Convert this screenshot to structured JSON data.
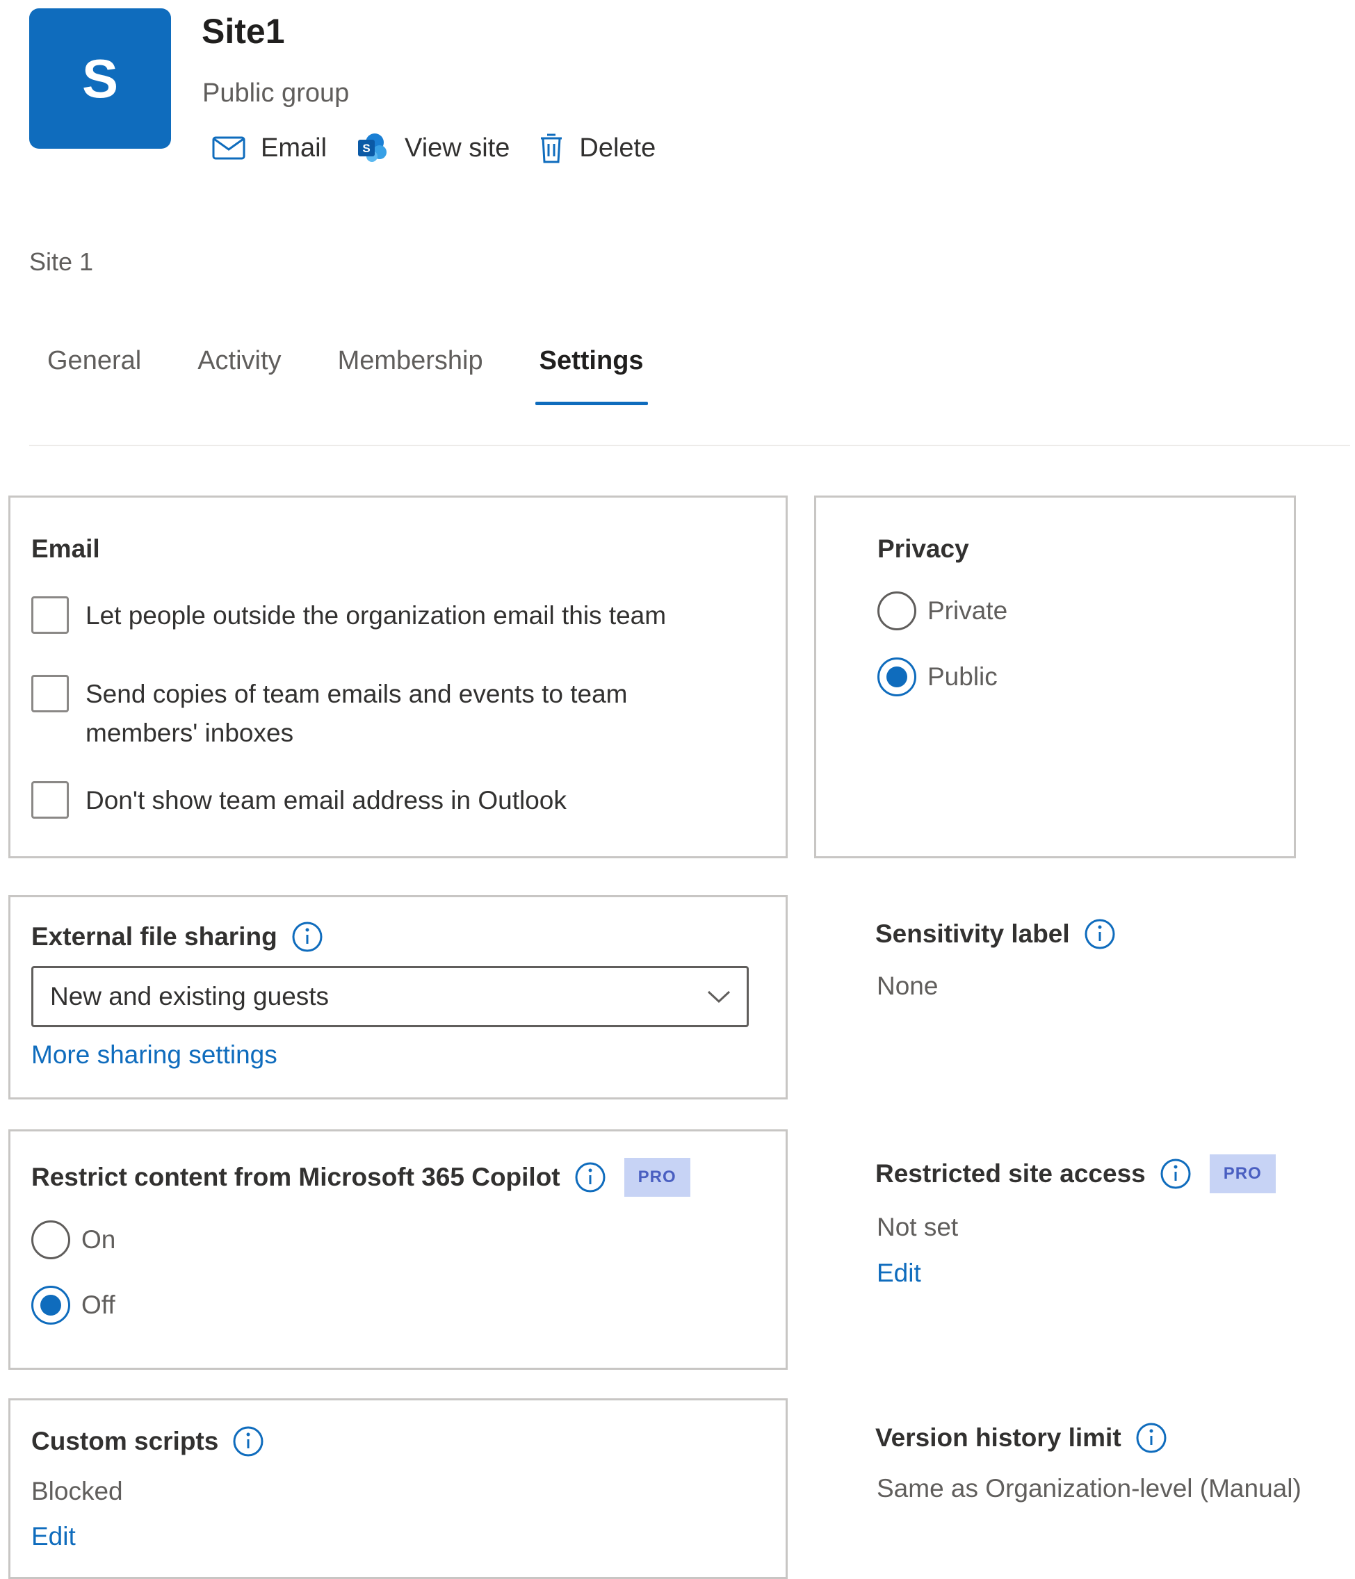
{
  "header": {
    "avatar_letter": "S",
    "title": "Site1",
    "subtitle": "Public group",
    "actions": {
      "email": "Email",
      "view_site": "View site",
      "delete": "Delete"
    }
  },
  "breadcrumb": "Site 1",
  "tabs": [
    {
      "label": "General",
      "active": false
    },
    {
      "label": "Activity",
      "active": false
    },
    {
      "label": "Membership",
      "active": false
    },
    {
      "label": "Settings",
      "active": true
    }
  ],
  "email_card": {
    "title": "Email",
    "options": [
      {
        "line1": "Let people outside the organization email this team",
        "line2": "",
        "checked": false
      },
      {
        "line1": "Send copies of team emails and events to team",
        "line2": "members' inboxes",
        "checked": false
      },
      {
        "line1": "Don't show team email address in Outlook",
        "line2": "",
        "checked": false
      }
    ]
  },
  "privacy_card": {
    "title": "Privacy",
    "options": [
      {
        "label": "Private",
        "selected": false
      },
      {
        "label": "Public",
        "selected": true
      }
    ]
  },
  "external_sharing": {
    "title": "External file sharing",
    "selected_value": "New and existing guests",
    "link": "More sharing settings"
  },
  "sensitivity_label": {
    "title": "Sensitivity label",
    "value": "None"
  },
  "copilot_restrict": {
    "title": "Restrict content from Microsoft 365 Copilot",
    "badge": "PRO",
    "options": [
      {
        "label": "On",
        "selected": false
      },
      {
        "label": "Off",
        "selected": true
      }
    ]
  },
  "restricted_access": {
    "title": "Restricted site access",
    "badge": "PRO",
    "value": "Not set",
    "link": "Edit"
  },
  "custom_scripts": {
    "title": "Custom scripts",
    "value": "Blocked",
    "link": "Edit"
  },
  "version_history": {
    "title": "Version history limit",
    "value": "Same as Organization-level (Manual)"
  },
  "colors": {
    "accent": "#0f6cbd",
    "badge_bg": "#c7d3f5",
    "border": "#c8c6c4"
  }
}
